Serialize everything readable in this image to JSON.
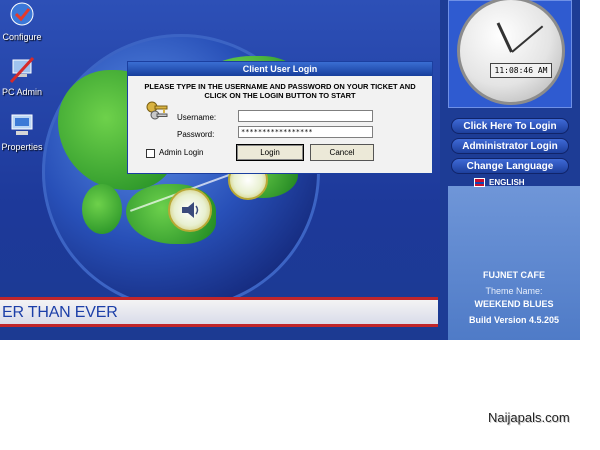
{
  "desktop_icons": [
    {
      "label": "Configure",
      "icon": "configure-icon"
    },
    {
      "label": "PC Admin",
      "icon": "pc-admin-icon"
    },
    {
      "label": "Properties",
      "icon": "properties-icon"
    }
  ],
  "banner": {
    "text": "ER THAN EVER"
  },
  "clock": {
    "time": "11:08:46 AM"
  },
  "side_buttons": [
    {
      "label": "Click Here To Login"
    },
    {
      "label": "Administrator Login"
    },
    {
      "label": "Change Language"
    }
  ],
  "language": {
    "label": "ENGLISH"
  },
  "info": {
    "cafe_name": "FUJNET CAFE",
    "theme_label": "Theme Name:",
    "theme_name": "WEEKEND BLUES",
    "build": "Build Version 4.5.205"
  },
  "dialog": {
    "title": "Client User Login",
    "instruction_line1": "PLEASE TYPE IN THE USERNAME AND PASSWORD ON YOUR TICKET AND",
    "instruction_line2": "CLICK ON THE LOGIN BUTTON TO START",
    "username_label": "Username:",
    "username_value": "",
    "password_label": "Password:",
    "password_value": "*****************",
    "admin_login_label": "Admin Login",
    "login_button": "Login",
    "cancel_button": "Cancel"
  },
  "watermark": {
    "text": "Naijapals.com"
  },
  "colors": {
    "banner_text": "#1c3fa8",
    "banner_border": "#c0262b",
    "panel_blue": "#1d3c95",
    "info_panel": "#5a84cc"
  }
}
